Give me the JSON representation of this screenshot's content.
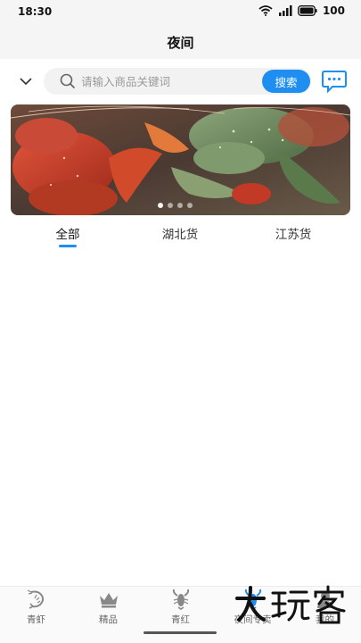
{
  "status_bar": {
    "time": "18:30",
    "battery": "100",
    "icons": [
      "wifi-icon",
      "signal-icon",
      "battery-icon"
    ]
  },
  "header": {
    "title": "夜间"
  },
  "search": {
    "placeholder": "请输入商品关键词",
    "value": "",
    "button_label": "搜索"
  },
  "tabs": [
    {
      "label": "全部",
      "active": true
    },
    {
      "label": "湖北货",
      "active": false
    },
    {
      "label": "江苏货",
      "active": false
    }
  ],
  "bottom_nav": [
    {
      "label": "青虾",
      "icon": "shrimp-icon"
    },
    {
      "label": "精品",
      "icon": "crown-icon"
    },
    {
      "label": "青红",
      "icon": "crayfish-icon"
    },
    {
      "label": "夜间专卖",
      "icon": "crayfish-icon",
      "active": true
    },
    {
      "label": "我的",
      "icon": "user-icon"
    }
  ],
  "watermark": {
    "text": "大玩客"
  },
  "colors": {
    "accent": "#1f8ef1",
    "background": "#ffffff",
    "header_bg": "#f5f5f5"
  }
}
